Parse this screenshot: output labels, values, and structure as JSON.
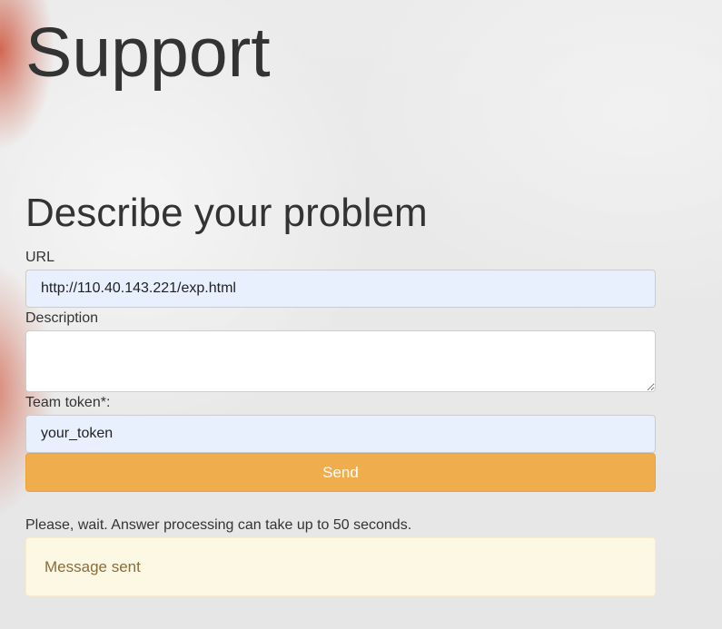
{
  "header": {
    "title": "Support"
  },
  "form": {
    "heading": "Describe your problem",
    "url_label": "URL",
    "url_value": "http://110.40.143.221/exp.html",
    "description_label": "Description",
    "description_value": "",
    "token_label": "Team token*:",
    "token_value": "your_token",
    "send_label": "Send"
  },
  "status": {
    "wait_text": "Please, wait. Answer processing can take up to 50 seconds.",
    "alert_text": "Message sent"
  },
  "colors": {
    "send_button": "#f0ad4e",
    "alert_background": "#fcf8e3",
    "alert_text": "#8a6d3b",
    "autofill_background": "#e8f0fe"
  }
}
